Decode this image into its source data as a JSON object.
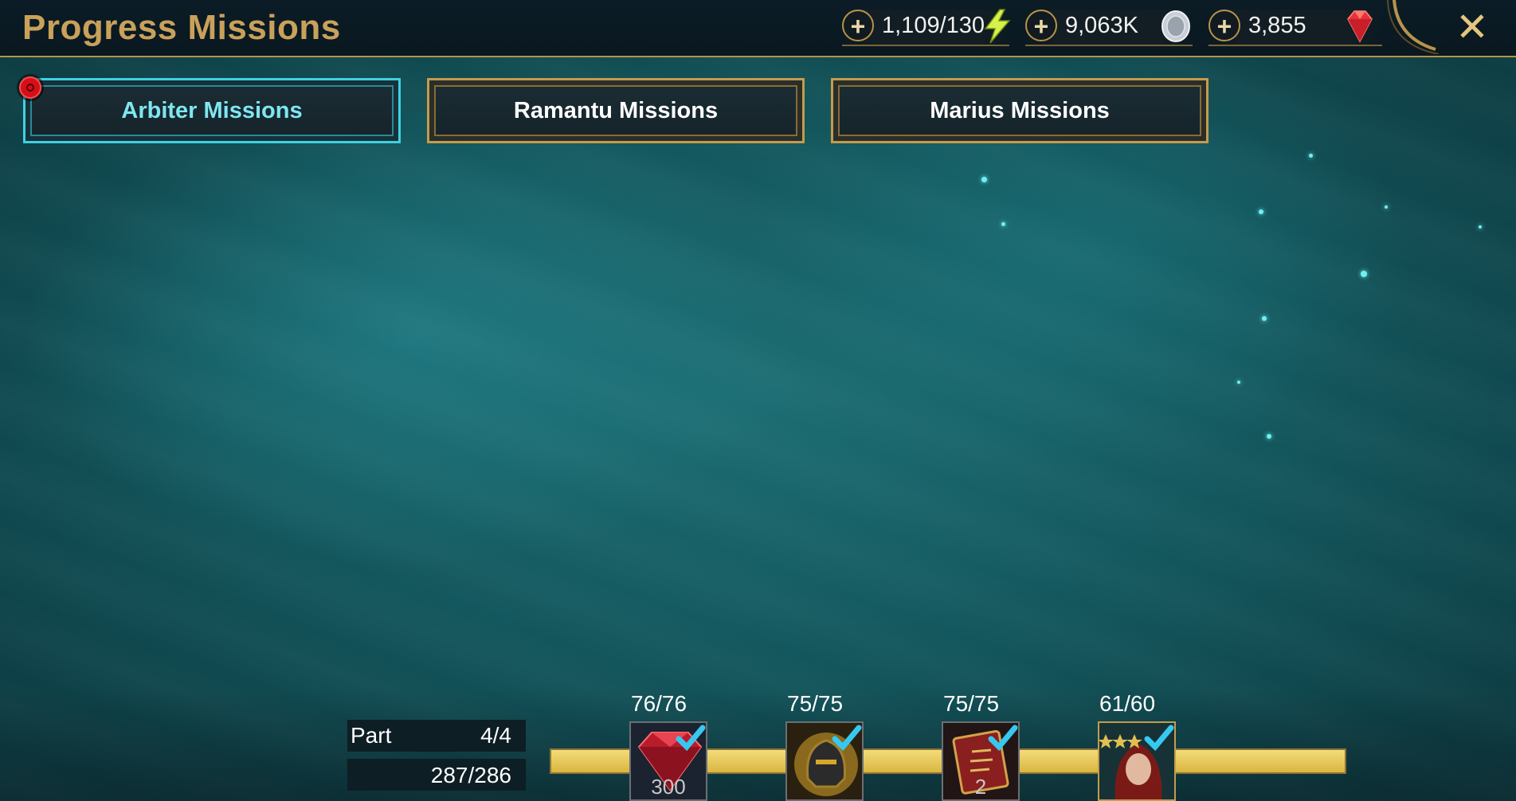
{
  "header": {
    "title": "Progress Missions",
    "resources": [
      {
        "icon": "lightning-energy-icon",
        "value": "1,109/130"
      },
      {
        "icon": "silver-coin-icon",
        "value": "9,063K"
      },
      {
        "icon": "ruby-gem-icon",
        "value": "3,855"
      }
    ],
    "close_label": "✕"
  },
  "tabs": [
    {
      "label": "Arbiter Missions",
      "active": true
    },
    {
      "label": "Ramantu Missions",
      "active": false
    },
    {
      "label": "Marius Missions",
      "active": false
    }
  ],
  "progress": {
    "part_label": "Part",
    "part_value": "4/4",
    "points_value": "287/286",
    "fill_fraction": 1.0,
    "milestones": [
      {
        "count": "76/76",
        "reward_icon": "gem-reward-icon",
        "qty": "300",
        "claimed": true
      },
      {
        "count": "75/75",
        "reward_icon": "helmet-reward-icon",
        "qty": "",
        "claimed": true
      },
      {
        "count": "75/75",
        "reward_icon": "tome-reward-icon",
        "qty": "2",
        "claimed": true
      },
      {
        "count": "61/60",
        "reward_icon": "champion-portrait-icon",
        "qty": "",
        "claimed": true
      }
    ]
  },
  "colors": {
    "accent_gold": "#c9a15a",
    "active_tab": "#3fd1e0",
    "progress_fill": "#e6c550",
    "check": "#36c8f0"
  }
}
